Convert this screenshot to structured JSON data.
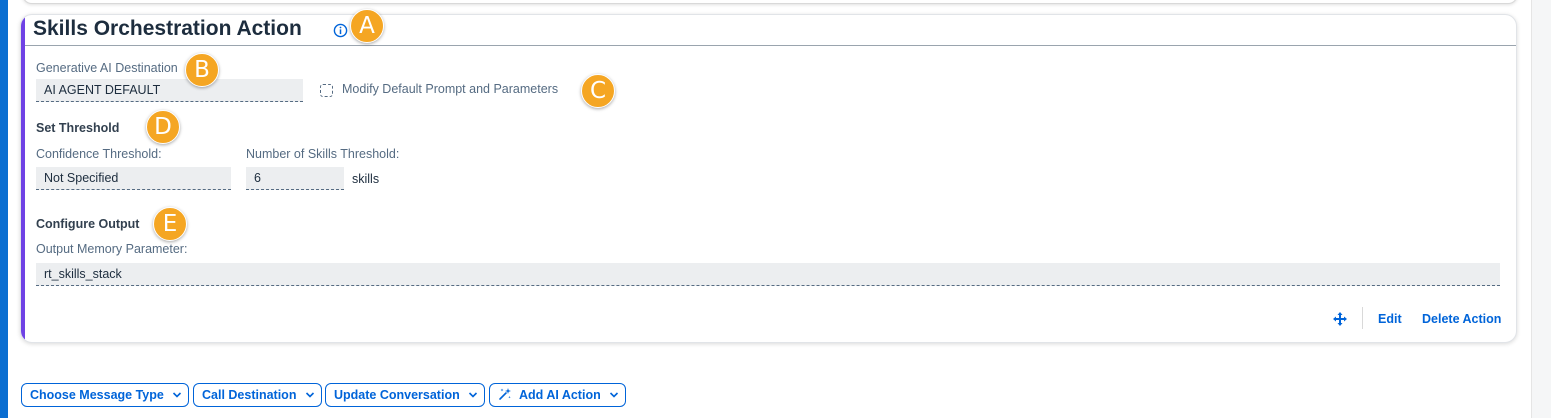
{
  "card": {
    "title": "Skills Orchestration Action",
    "info_icon": "info-icon",
    "accent_color": "#6f42e5"
  },
  "destination": {
    "label": "Generative AI Destination",
    "value": "AI AGENT DEFAULT",
    "modify_label": "Modify Default Prompt and Parameters",
    "modify_checked": false
  },
  "threshold": {
    "section_title": "Set Threshold",
    "confidence_label": "Confidence Threshold:",
    "confidence_value": "Not Specified",
    "skills_label": "Number of Skills Threshold:",
    "skills_value": "6",
    "skills_unit": "skills"
  },
  "output": {
    "section_title": "Configure Output",
    "memory_label": "Output Memory Parameter:",
    "memory_value": "rt_skills_stack"
  },
  "footer": {
    "move_icon": "move-icon",
    "edit_label": "Edit",
    "delete_label": "Delete Action"
  },
  "add_menu": [
    {
      "label": "Choose Message Type"
    },
    {
      "label": "Call Destination"
    },
    {
      "label": "Update Conversation"
    },
    {
      "label": "Add AI Action",
      "icon": "ai-sparkle-icon"
    }
  ],
  "markers": [
    "A",
    "B",
    "C",
    "D",
    "E"
  ],
  "colors": {
    "brand_blue": "#0064d9",
    "marker_orange": "#f5a623"
  }
}
